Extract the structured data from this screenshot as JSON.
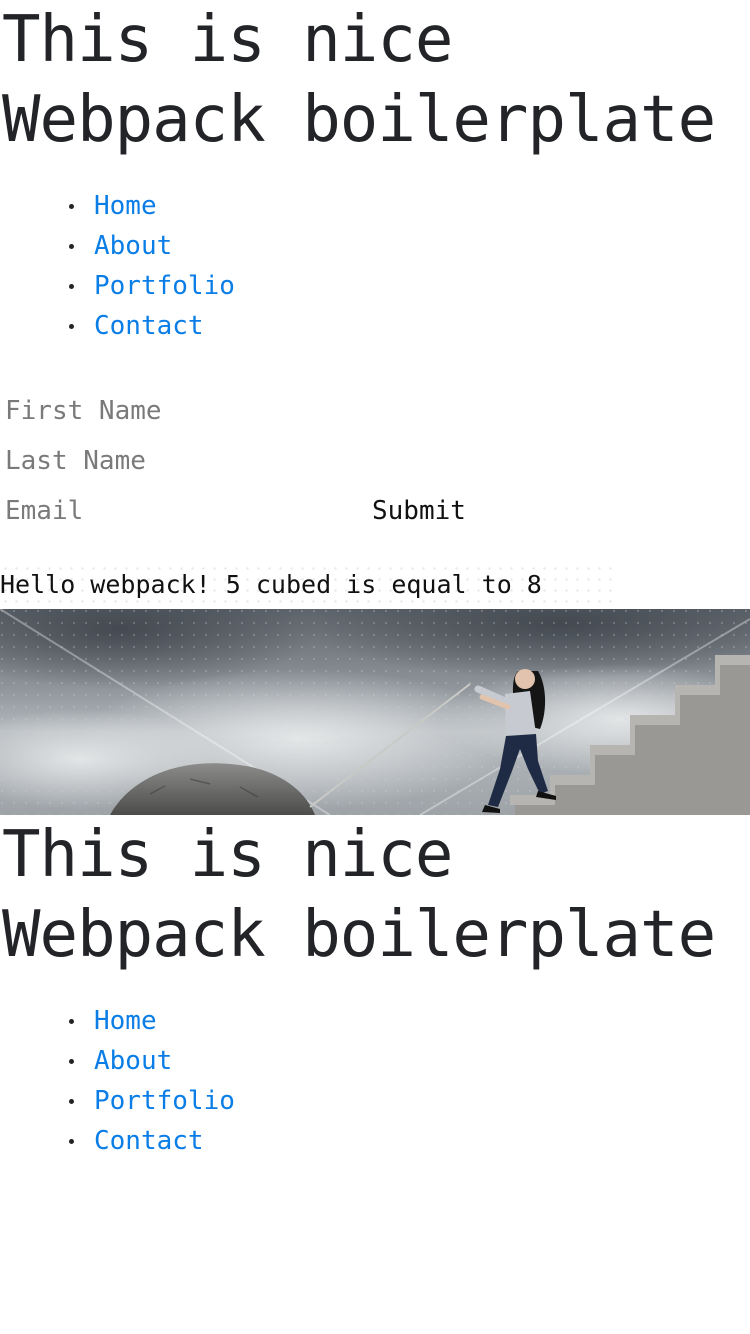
{
  "header": {
    "title": "This is nice Webpack boilerplate"
  },
  "nav": {
    "items": [
      {
        "label": "Home"
      },
      {
        "label": "About"
      },
      {
        "label": "Portfolio"
      },
      {
        "label": "Contact"
      }
    ]
  },
  "form": {
    "first_name_placeholder": "First Name",
    "last_name_placeholder": "Last Name",
    "email_placeholder": "Email",
    "submit_label": "Submit"
  },
  "message": {
    "text": "Hello webpack! 5 cubed is equal to 8"
  },
  "banner": {
    "alt": "Woman pulling a boulder up concrete stairs under a cloudy sky"
  },
  "footer_section": {
    "title": "This is nice Webpack boilerplate",
    "items": [
      {
        "label": "Home"
      },
      {
        "label": "About"
      },
      {
        "label": "Portfolio"
      },
      {
        "label": "Contact"
      }
    ]
  },
  "colors": {
    "link": "#0a7ee6",
    "text": "#222428",
    "placeholder": "#7a7a7a"
  }
}
